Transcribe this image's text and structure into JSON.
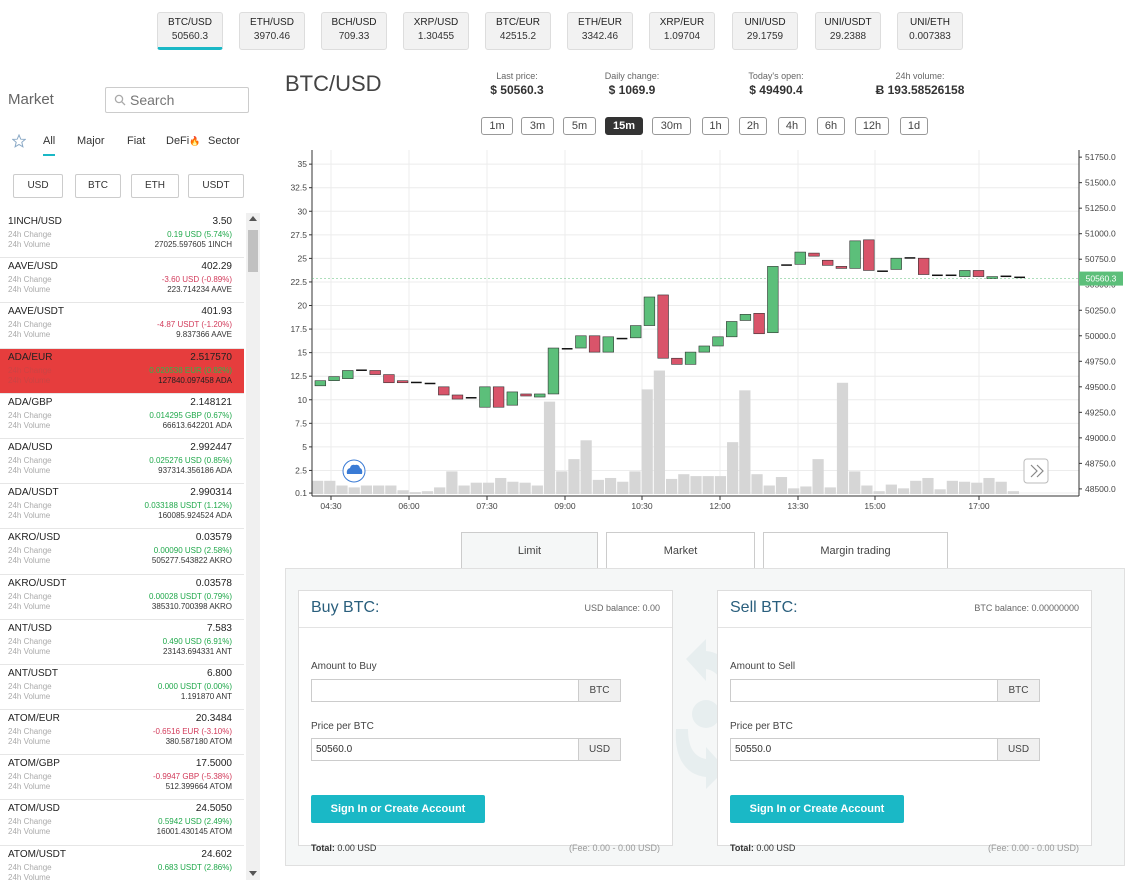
{
  "ticker": [
    {
      "pair": "BTC/USD",
      "price": "50560.3"
    },
    {
      "pair": "ETH/USD",
      "price": "3970.46"
    },
    {
      "pair": "BCH/USD",
      "price": "709.33"
    },
    {
      "pair": "XRP/USD",
      "price": "1.30455"
    },
    {
      "pair": "BTC/EUR",
      "price": "42515.2"
    },
    {
      "pair": "ETH/EUR",
      "price": "3342.46"
    },
    {
      "pair": "XRP/EUR",
      "price": "1.09704"
    },
    {
      "pair": "UNI/USD",
      "price": "29.1759"
    },
    {
      "pair": "UNI/USDT",
      "price": "29.2388"
    },
    {
      "pair": "UNI/ETH",
      "price": "0.007383"
    }
  ],
  "sidebar": {
    "title": "Market",
    "search_placeholder": "Search",
    "tabs": [
      "All",
      "Major",
      "Fiat",
      "DeFi",
      "Sector"
    ],
    "defi_badge": "🔥",
    "quotes": [
      "USD",
      "BTC",
      "ETH",
      "USDT"
    ],
    "change_label": "24h Change",
    "volume_label": "24h Volume",
    "pairs": [
      {
        "name": "1INCH/USD",
        "price": "3.50",
        "change": "0.19 USD  (5.74%)",
        "dir": "pos",
        "volume": "27025.597605 1INCH"
      },
      {
        "name": "AAVE/USD",
        "price": "402.29",
        "change": "-3.60 USD  (-0.89%)",
        "dir": "neg",
        "volume": "223.714234 AAVE"
      },
      {
        "name": "AAVE/USDT",
        "price": "401.93",
        "change": "-4.87 USDT  (-1.20%)",
        "dir": "neg",
        "volume": "9.837366 AAVE"
      },
      {
        "name": "ADA/EUR",
        "price": "2.517570",
        "change": "0.020538 EUR  (0.82%)",
        "dir": "pos",
        "volume": "127840.097458 ADA"
      },
      {
        "name": "ADA/GBP",
        "price": "2.148121",
        "change": "0.014295 GBP  (0.67%)",
        "dir": "pos",
        "volume": "66613.642201 ADA"
      },
      {
        "name": "ADA/USD",
        "price": "2.992447",
        "change": "0.025276 USD  (0.85%)",
        "dir": "pos",
        "volume": "937314.356186 ADA"
      },
      {
        "name": "ADA/USDT",
        "price": "2.990314",
        "change": "0.033188 USDT  (1.12%)",
        "dir": "pos",
        "volume": "160085.924524 ADA"
      },
      {
        "name": "AKRO/USD",
        "price": "0.03579",
        "change": "0.00090 USD  (2.58%)",
        "dir": "pos",
        "volume": "505277.543822 AKRO"
      },
      {
        "name": "AKRO/USDT",
        "price": "0.03578",
        "change": "0.00028 USDT  (0.79%)",
        "dir": "pos",
        "volume": "385310.700398 AKRO"
      },
      {
        "name": "ANT/USD",
        "price": "7.583",
        "change": "0.490 USD  (6.91%)",
        "dir": "pos",
        "volume": "23143.694331 ANT"
      },
      {
        "name": "ANT/USDT",
        "price": "6.800",
        "change": "0.000 USDT  (0.00%)",
        "dir": "pos",
        "volume": "1.191870 ANT"
      },
      {
        "name": "ATOM/EUR",
        "price": "20.3484",
        "change": "-0.6516 EUR  (-3.10%)",
        "dir": "neg",
        "volume": "380.587180 ATOM"
      },
      {
        "name": "ATOM/GBP",
        "price": "17.5000",
        "change": "-0.9947 GBP  (-5.38%)",
        "dir": "neg",
        "volume": "512.399664 ATOM"
      },
      {
        "name": "ATOM/USD",
        "price": "24.5050",
        "change": "0.5942 USD  (2.49%)",
        "dir": "pos",
        "volume": "16001.430145 ATOM"
      },
      {
        "name": "ATOM/USDT",
        "price": "24.602",
        "change": "0.683 USDT  (2.86%)",
        "dir": "pos",
        "volume": ""
      }
    ]
  },
  "header": {
    "pair": "BTC/USD",
    "stats": [
      {
        "label": "Last price:",
        "value": "$ 50560.3"
      },
      {
        "label": "Daily change:",
        "value": "$ 1069.9"
      },
      {
        "label": "Today's open:",
        "value": "$ 49490.4"
      },
      {
        "label": "24h volume:",
        "value": "Ƀ 193.58526158"
      }
    ],
    "intervals": [
      "1m",
      "3m",
      "5m",
      "15m",
      "30m",
      "1h",
      "2h",
      "4h",
      "6h",
      "12h",
      "1d"
    ],
    "active_interval": "15m"
  },
  "chart_data": {
    "type": "candlestick",
    "x_ticks": [
      "04:30",
      "06:00",
      "07:30",
      "09:00",
      "10:30",
      "12:00",
      "13:30",
      "15:00",
      "17:00"
    ],
    "volume_axis_ticks": [
      "0.1",
      "2.5",
      "5",
      "7.5",
      "10",
      "12.5",
      "15",
      "17.5",
      "20",
      "22.5",
      "25",
      "27.5",
      "30",
      "32.5",
      "35"
    ],
    "price_axis_ticks": [
      "48500.0",
      "48750.0",
      "49000.0",
      "49250.0",
      "49500.0",
      "49750.0",
      "50000.0",
      "50250.0",
      "50500.0",
      "50750.0",
      "51000.0",
      "51250.0",
      "51500.0",
      "51750.0"
    ],
    "ylim_price": [
      48450,
      51820
    ],
    "ylim_volume": [
      0,
      36.5
    ],
    "last_price_label": "50560.3",
    "candles": [
      {
        "o": 49510,
        "c": 49560
      },
      {
        "o": 49560,
        "c": 49600
      },
      {
        "o": 49580,
        "c": 49660
      },
      {
        "o": 49660,
        "c": 49670
      },
      {
        "o": 49660,
        "c": 49620
      },
      {
        "o": 49620,
        "c": 49540
      },
      {
        "o": 49560,
        "c": 49540
      },
      {
        "o": 49550,
        "c": 49540
      },
      {
        "o": 49540,
        "c": 49530
      },
      {
        "o": 49500,
        "c": 49420
      },
      {
        "o": 49420,
        "c": 49380
      },
      {
        "o": 49400,
        "c": 49390
      },
      {
        "o": 49300,
        "c": 49500
      },
      {
        "o": 49500,
        "c": 49300
      },
      {
        "o": 49320,
        "c": 49450
      },
      {
        "o": 49430,
        "c": 49410
      },
      {
        "o": 49400,
        "c": 49430
      },
      {
        "o": 49430,
        "c": 49880
      },
      {
        "o": 49880,
        "c": 49880
      },
      {
        "o": 49880,
        "c": 50000
      },
      {
        "o": 50000,
        "c": 49840
      },
      {
        "o": 49840,
        "c": 49990
      },
      {
        "o": 49980,
        "c": 49970
      },
      {
        "o": 49980,
        "c": 50100
      },
      {
        "o": 50100,
        "c": 50380
      },
      {
        "o": 50400,
        "c": 49780
      },
      {
        "o": 49780,
        "c": 49720
      },
      {
        "o": 49720,
        "c": 49840
      },
      {
        "o": 49840,
        "c": 49900
      },
      {
        "o": 49900,
        "c": 49990
      },
      {
        "o": 49990,
        "c": 50140
      },
      {
        "o": 50150,
        "c": 50210
      },
      {
        "o": 50220,
        "c": 50020
      },
      {
        "o": 50030,
        "c": 50680
      },
      {
        "o": 50690,
        "c": 50700
      },
      {
        "o": 50700,
        "c": 50820
      },
      {
        "o": 50810,
        "c": 50780
      },
      {
        "o": 50740,
        "c": 50690
      },
      {
        "o": 50680,
        "c": 50660
      },
      {
        "o": 50660,
        "c": 50930
      },
      {
        "o": 50940,
        "c": 50640
      },
      {
        "o": 50640,
        "c": 50640
      },
      {
        "o": 50650,
        "c": 50760
      },
      {
        "o": 50770,
        "c": 50770
      },
      {
        "o": 50760,
        "c": 50600
      },
      {
        "o": 50600,
        "c": 50600
      },
      {
        "o": 50600,
        "c": 50590
      },
      {
        "o": 50580,
        "c": 50640
      },
      {
        "o": 50640,
        "c": 50580
      },
      {
        "o": 50560,
        "c": 50580
      },
      {
        "o": 50580,
        "c": 50590
      },
      {
        "o": 50580,
        "c": 50570
      }
    ],
    "volumes": [
      1.4,
      1.4,
      0.9,
      0.7,
      0.9,
      0.9,
      0.9,
      0.4,
      0.2,
      0.3,
      0.7,
      2.4,
      0.9,
      1.2,
      1.2,
      1.7,
      1.3,
      1.2,
      0.9,
      9.8,
      2.4,
      3.7,
      5.7,
      1.5,
      1.7,
      1.3,
      2.4,
      11.1,
      13.1,
      1.6,
      2.1,
      1.9,
      1.9,
      1.9,
      5.5,
      11.0,
      2.1,
      0.9,
      1.8,
      0.6,
      0.8,
      3.7,
      0.7,
      11.8,
      2.4,
      0.9,
      0.3,
      1.0,
      0.6,
      1.4,
      1.7,
      0.5,
      1.4,
      1.3,
      1.2,
      1.7,
      1.3,
      0.3
    ]
  },
  "order_tabs": [
    "Limit",
    "Market",
    "Margin trading"
  ],
  "buy": {
    "title": "Buy BTC:",
    "balance": "USD balance: 0.00",
    "amount_label": "Amount to Buy",
    "amount_unit": "BTC",
    "price_label": "Price per BTC",
    "price_value": "50560.0",
    "price_unit": "USD",
    "button": "Sign In or Create Account",
    "total_label": "Total:",
    "total_value": "0.00 USD",
    "fee": "(Fee: 0.00 - 0.00 USD)"
  },
  "sell": {
    "title": "Sell BTC:",
    "balance": "BTC balance: 0.00000000",
    "amount_label": "Amount to Sell",
    "amount_unit": "BTC",
    "price_label": "Price per BTC",
    "price_value": "50550.0",
    "price_unit": "USD",
    "button": "Sign In or Create Account",
    "total_label": "Total:",
    "total_value": "0.00 USD",
    "fee": "(Fee: 0.00 - 0.00 USD)"
  },
  "colors": {
    "accent": "#1ab8c6",
    "up": "#5cbf7a",
    "down": "#d9546a",
    "selected_row": "#e63d3d"
  }
}
